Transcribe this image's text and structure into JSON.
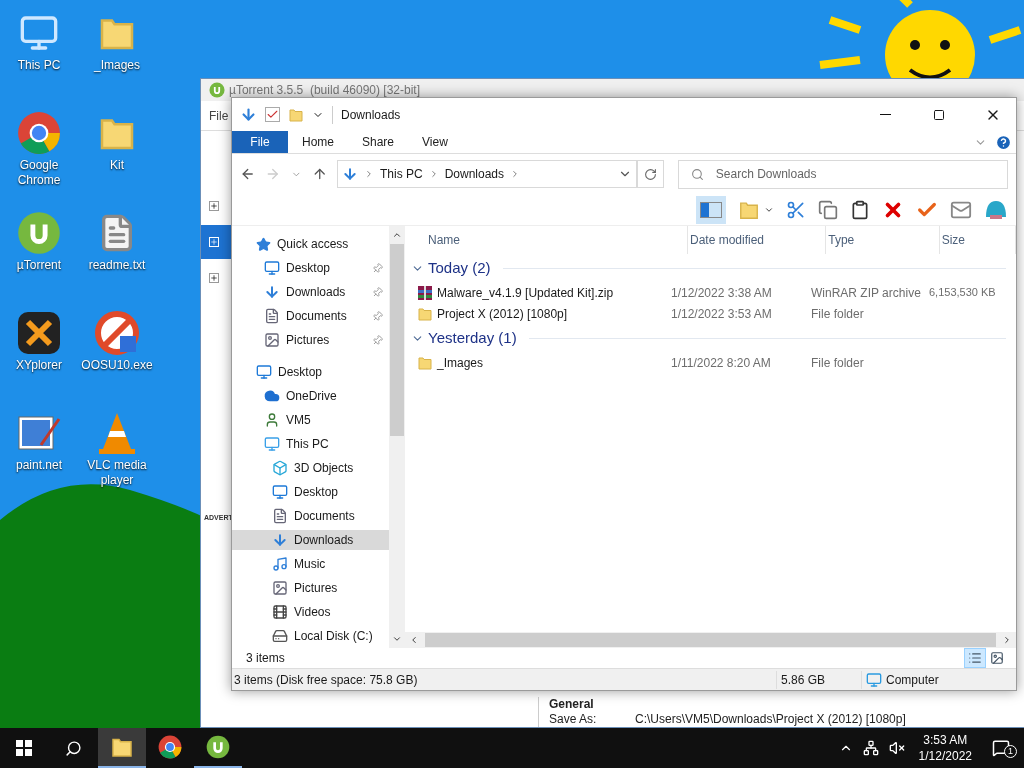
{
  "desktop_icons": [
    {
      "label": "This PC"
    },
    {
      "label": "_Images"
    },
    {
      "label": "Google Chrome"
    },
    {
      "label": "Kit"
    },
    {
      "label": "µTorrent"
    },
    {
      "label": "readme.txt"
    },
    {
      "label": "XYplorer"
    },
    {
      "label": "OOSU10.exe"
    },
    {
      "label": "paint.net"
    },
    {
      "label": "VLC media player"
    }
  ],
  "utorrent": {
    "title": "µTorrent 3.5.5  (build 46090) [32-bit]",
    "menu": [
      "File"
    ],
    "ad_label": "ADVERT",
    "general_heading": "General",
    "fields": [
      {
        "label": "Save As:",
        "value": "C:\\Users\\VM5\\Downloads\\Project X (2012) [1080p]"
      }
    ]
  },
  "explorer": {
    "title": "Downloads",
    "ribbon_tabs": [
      {
        "label": "File",
        "kind": "file"
      },
      {
        "label": "Home",
        "kind": "tab"
      },
      {
        "label": "Share",
        "kind": "tab"
      },
      {
        "label": "View",
        "kind": "tab"
      }
    ],
    "breadcrumb": [
      "This PC",
      "Downloads"
    ],
    "search": {
      "placeholder": "Search Downloads"
    },
    "nav": [
      {
        "label": "Quick access",
        "selected": false,
        "pinned": false,
        "children": [
          {
            "label": "Desktop",
            "selected": false,
            "pinned": true
          },
          {
            "label": "Downloads",
            "selected": false,
            "pinned": true
          },
          {
            "label": "Documents",
            "selected": false,
            "pinned": true
          },
          {
            "label": "Pictures",
            "selected": false,
            "pinned": true
          }
        ]
      },
      {
        "label": "Desktop",
        "selected": false,
        "pinned": false,
        "children": [
          {
            "label": "OneDrive",
            "selected": false,
            "pinned": false
          },
          {
            "label": "VM5",
            "selected": false,
            "pinned": false
          },
          {
            "label": "This PC",
            "selected": false,
            "pinned": false,
            "children": [
              {
                "label": "3D Objects",
                "selected": false,
                "pinned": false
              },
              {
                "label": "Desktop",
                "selected": false,
                "pinned": false
              },
              {
                "label": "Documents",
                "selected": false,
                "pinned": false
              },
              {
                "label": "Downloads",
                "selected": true,
                "pinned": false
              },
              {
                "label": "Music",
                "selected": false,
                "pinned": false
              },
              {
                "label": "Pictures",
                "selected": false,
                "pinned": false
              },
              {
                "label": "Videos",
                "selected": false,
                "pinned": false
              },
              {
                "label": "Local Disk (C:)",
                "selected": false,
                "pinned": false
              }
            ]
          }
        ]
      }
    ],
    "columns": [
      "Name",
      "Date modified",
      "Type",
      "Size"
    ],
    "groups": [
      {
        "label": "Today (2)",
        "expanded": true,
        "files": [
          {
            "kind": "archive",
            "name": "Malware_v4.1.9 [Updated Kit].zip",
            "date": "1/12/2022 3:38 AM",
            "type": "WinRAR ZIP archive",
            "size": "6,153,530 KB"
          },
          {
            "kind": "folder",
            "name": "Project X (2012) [1080p]",
            "date": "1/12/2022 3:53 AM",
            "type": "File folder"
          }
        ]
      },
      {
        "label": "Yesterday (1)",
        "expanded": true,
        "files": [
          {
            "kind": "folder",
            "name": "_Images",
            "date": "1/11/2022 8:20 AM",
            "type": "File folder"
          }
        ]
      }
    ],
    "item_count": "3 items",
    "view_buttons": [
      {
        "selected": true
      },
      {
        "selected": false
      }
    ],
    "status": {
      "summary": "3 items (Disk free space: 75.8 GB)",
      "size": "5.86 GB",
      "location": "Computer"
    }
  },
  "taskbar": {
    "apps": [
      {
        "running": true,
        "active": true
      },
      {
        "running": false,
        "active": false
      },
      {
        "running": true,
        "active": false
      }
    ],
    "time": "3:53 AM",
    "date": "1/12/2022",
    "notifications": "1"
  }
}
